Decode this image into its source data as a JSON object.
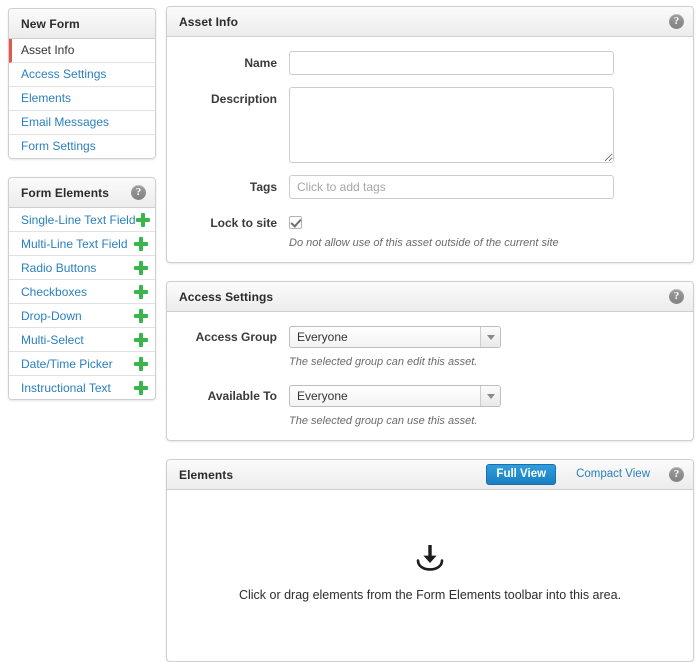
{
  "sidebar": {
    "nav": {
      "title": "New Form",
      "help_icon": "help-icon",
      "items": [
        {
          "label": "Asset Info",
          "active": true
        },
        {
          "label": "Access Settings",
          "active": false
        },
        {
          "label": "Elements",
          "active": false
        },
        {
          "label": "Email Messages",
          "active": false
        },
        {
          "label": "Form Settings",
          "active": false
        }
      ]
    },
    "form_elements": {
      "title": "Form Elements",
      "help_icon": "help-icon",
      "add_icon": "plus-icon",
      "items": [
        {
          "label": "Single-Line Text Field"
        },
        {
          "label": "Multi-Line Text Field"
        },
        {
          "label": "Radio Buttons"
        },
        {
          "label": "Checkboxes"
        },
        {
          "label": "Drop-Down"
        },
        {
          "label": "Multi-Select"
        },
        {
          "label": "Date/Time Picker"
        },
        {
          "label": "Instructional Text"
        }
      ]
    }
  },
  "asset_info": {
    "title": "Asset Info",
    "help_icon": "help-icon",
    "name": {
      "label": "Name",
      "value": "",
      "placeholder": ""
    },
    "description": {
      "label": "Description",
      "value": "",
      "placeholder": ""
    },
    "tags": {
      "label": "Tags",
      "value": "",
      "placeholder": "Click to add tags"
    },
    "lock_to_site": {
      "label": "Lock to site",
      "checked": true,
      "hint": "Do not allow use of this asset outside of the current site"
    }
  },
  "access_settings": {
    "title": "Access Settings",
    "help_icon": "help-icon",
    "access_group": {
      "label": "Access Group",
      "value": "Everyone",
      "hint": "The selected group can edit this asset.",
      "caret_icon": "chevron-down-icon"
    },
    "available_to": {
      "label": "Available To",
      "value": "Everyone",
      "hint": "The selected group can use this asset.",
      "caret_icon": "chevron-down-icon"
    }
  },
  "elements": {
    "title": "Elements",
    "help_icon": "help-icon",
    "full_view_label": "Full View",
    "compact_view_label": "Compact View",
    "drop_icon": "download-into-tray-icon",
    "drop_text": "Click or drag elements from the Form Elements toolbar into this area."
  },
  "colors": {
    "accent_blue": "#1a7fc1",
    "link_blue": "#2a7fbe",
    "active_red": "#e0594b",
    "plus_green": "#39b54a",
    "panel_border": "#cfcfcf"
  }
}
